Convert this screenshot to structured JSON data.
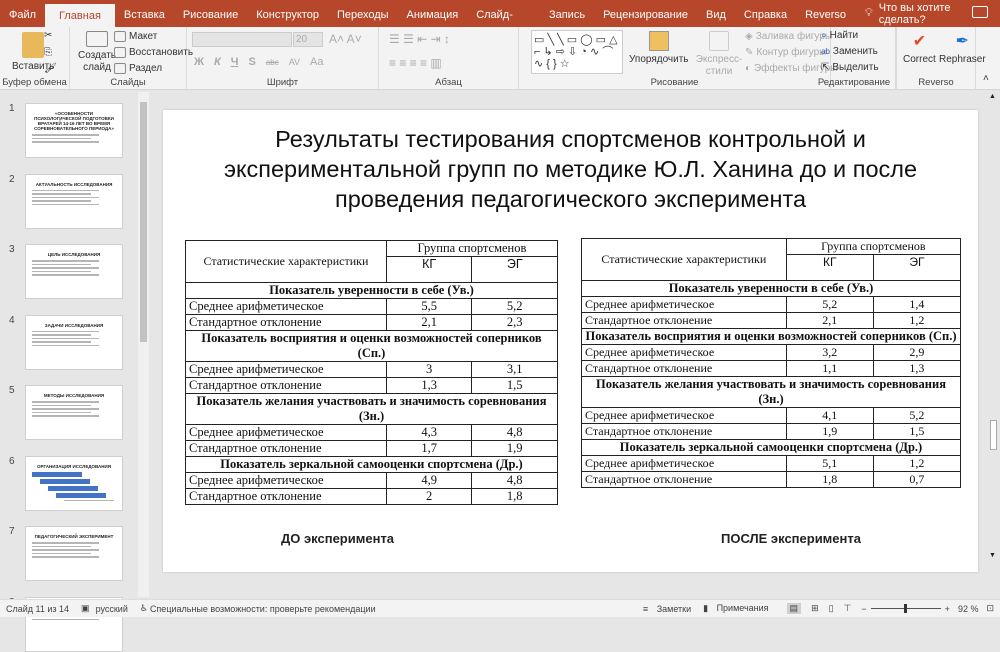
{
  "tabs": [
    "Файл",
    "Главная",
    "Вставка",
    "Рисование",
    "Конструктор",
    "Переходы",
    "Анимация",
    "Слайд-шоу",
    "Запись",
    "Рецензирование",
    "Вид",
    "Справка",
    "Reverso"
  ],
  "tell_me": "Что вы хотите сделать?",
  "ribbon": {
    "clipboard": {
      "paste": "Вставить",
      "label": "Буфер обмена"
    },
    "slides": {
      "new_slide": "Создать слайд",
      "layout": "Макет",
      "reset": "Восстановить",
      "section": "Раздел",
      "label": "Слайды"
    },
    "font": {
      "size": "20",
      "bold": "Ж",
      "italic": "К",
      "underline": "Ч",
      "shadow": "S",
      "strike": "abc",
      "spacing": "AV",
      "case": "Aa",
      "label": "Шрифт"
    },
    "paragraph": {
      "label": "Абзац"
    },
    "drawing": {
      "arrange": "Упорядочить",
      "quick_styles": "Экспресс-стили",
      "fill": "Заливка фигуры",
      "outline": "Контур фигуры",
      "effects": "Эффекты фигуры",
      "label": "Рисование"
    },
    "editing": {
      "find": "Найти",
      "replace": "Заменить",
      "select": "Выделить",
      "label": "Редактирование"
    },
    "reverso": {
      "correct": "Correct",
      "rephraser": "Rephraser",
      "label": "Reverso"
    }
  },
  "thumbnails": [
    {
      "num": "1",
      "title": "«ОСОБЕННОСТИ ПСИХОЛОГИЧЕСКОЙ ПОДГОТОВКИ ВРАТАРЕЙ 14-16 ЛЕТ ВО ВРЕМЯ СОРЕВНОВАТЕЛЬНОГО ПЕРИОДА»"
    },
    {
      "num": "2",
      "title": "АКТУАЛЬНОСТЬ ИССЛЕДОВАНИЯ"
    },
    {
      "num": "3",
      "title": "ЦЕЛЬ ИССЛЕДОВАНИЯ"
    },
    {
      "num": "4",
      "title": "ЗАДАЧИ ИССЛЕДОВАНИЯ"
    },
    {
      "num": "5",
      "title": "МЕТОДЫ ИССЛЕДОВАНИЯ"
    },
    {
      "num": "6",
      "title": "ОРГАНИЗАЦИЯ ИССЛЕДОВАНИЯ"
    },
    {
      "num": "7",
      "title": "ПЕДАГОГИЧЕСКИЙ ЭКСПЕРИМЕНТ"
    },
    {
      "num": "8",
      "title": ""
    }
  ],
  "slide": {
    "title": "Результаты тестирования спортсменов контрольной и экспериментальной групп по методике Ю.Л. Ханина до и после проведения педагогического эксперимента",
    "caption_before": "ДО эксперимента",
    "caption_after": "ПОСЛЕ эксперимента",
    "header": {
      "stat": "Статистические характеристики",
      "group": "Группа спортсменов",
      "kg": "КГ",
      "eg": "ЭГ"
    },
    "sections": [
      "Показатель уверенности в себе (Ув.)",
      "Показатель восприятия и оценки возможностей соперников (Сп.)",
      "Показатель желания участвовать и значимость соревнования (Зн.)",
      "Показатель зеркальной самооценки спортсмена (Др.)"
    ],
    "row_labels": [
      "Среднее арифметическое",
      "Стандартное отклонение"
    ],
    "before": [
      [
        [
          "5,5",
          "5,2"
        ],
        [
          "2,1",
          "2,3"
        ]
      ],
      [
        [
          "3",
          "3,1"
        ],
        [
          "1,3",
          "1,5"
        ]
      ],
      [
        [
          "4,3",
          "4,8"
        ],
        [
          "1,7",
          "1,9"
        ]
      ],
      [
        [
          "4,9",
          "4,8"
        ],
        [
          "2",
          "1,8"
        ]
      ]
    ],
    "after": [
      [
        [
          "5,2",
          "1,4"
        ],
        [
          "2,1",
          "1,2"
        ]
      ],
      [
        [
          "3,2",
          "2,9"
        ],
        [
          "1,1",
          "1,3"
        ]
      ],
      [
        [
          "4,1",
          "5,2"
        ],
        [
          "1,9",
          "1,5"
        ]
      ],
      [
        [
          "5,1",
          "1,2"
        ],
        [
          "1,8",
          "0,7"
        ]
      ]
    ]
  },
  "status": {
    "slide": "Слайд 11 из 14",
    "language": "русский",
    "accessibility": "Специальные возможности: проверьте рекомендации",
    "notes": "Заметки",
    "comments": "Примечания",
    "zoom": "92 %"
  },
  "colors": {
    "accent": "#b7472a"
  }
}
